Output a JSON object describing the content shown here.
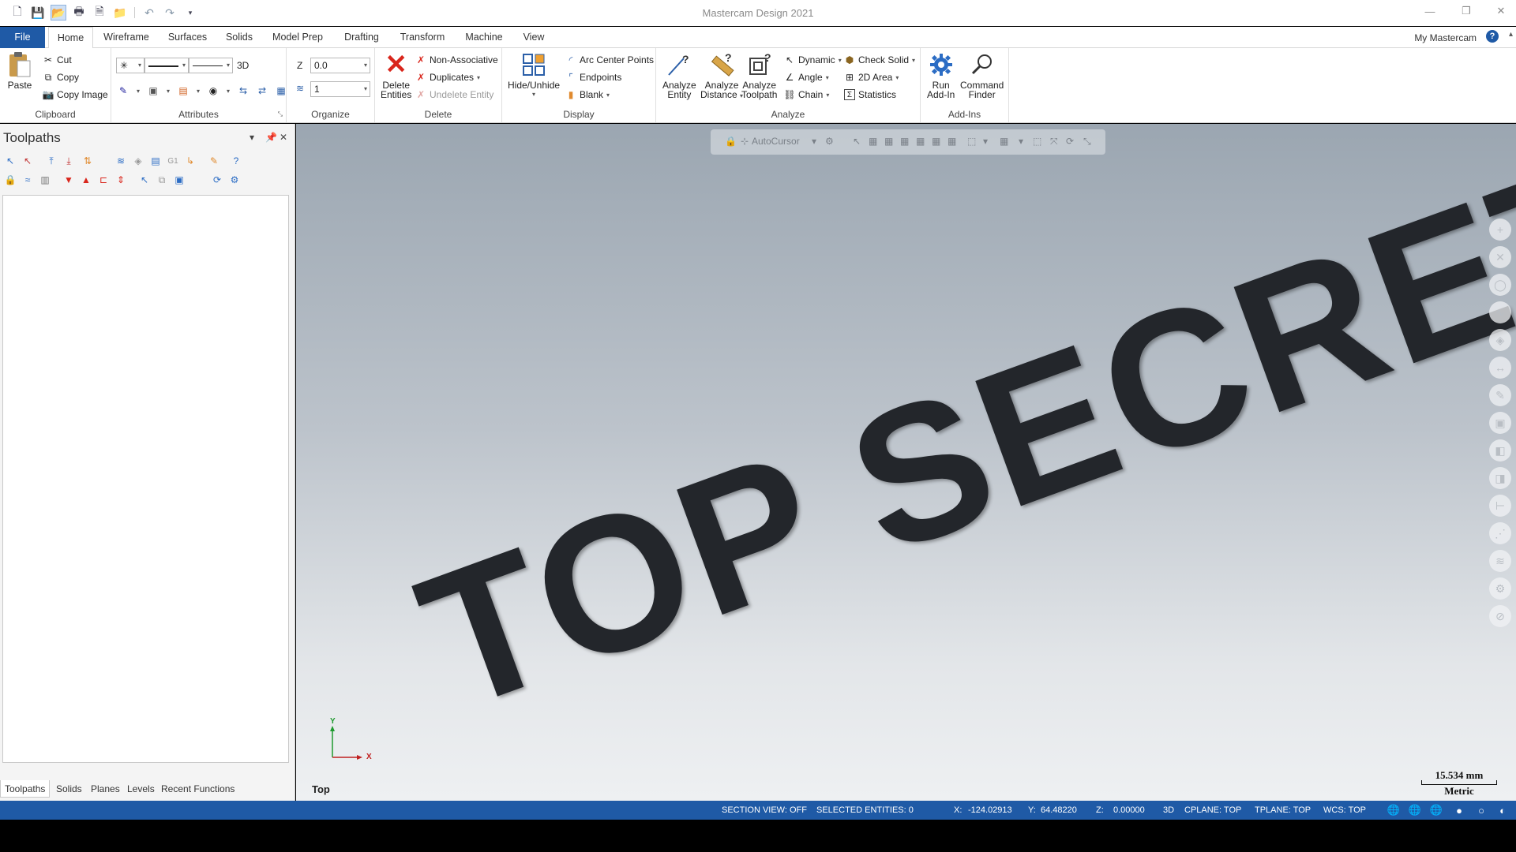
{
  "window": {
    "title": "Mastercam Design 2021"
  },
  "ribbon_tabs": [
    {
      "label": "File"
    },
    {
      "label": "Home"
    },
    {
      "label": "Wireframe"
    },
    {
      "label": "Surfaces"
    },
    {
      "label": "Solids"
    },
    {
      "label": "Model Prep"
    },
    {
      "label": "Drafting"
    },
    {
      "label": "Transform"
    },
    {
      "label": "Machine"
    },
    {
      "label": "View"
    }
  ],
  "header_right": {
    "account": "My Mastercam",
    "help": "?"
  },
  "clipboard": {
    "paste": "Paste",
    "cut": "Cut",
    "copy": "Copy",
    "copy_image": "Copy Image",
    "label": "Clipboard"
  },
  "attributes": {
    "mode": "3D",
    "label": "Attributes"
  },
  "organize": {
    "z_label": "Z",
    "z_value": "0.0",
    "level_value": "1",
    "label": "Organize"
  },
  "delete": {
    "delete_entities": "Delete\nEntities",
    "delete_line1": "Delete",
    "delete_line2": "Entities",
    "non_associative": "Non-Associative",
    "duplicates": "Duplicates",
    "undelete": "Undelete Entity",
    "label": "Delete"
  },
  "display": {
    "hide_unhide": "Hide/Unhide",
    "arc_center_points": "Arc Center Points",
    "endpoints": "Endpoints",
    "blank": "Blank",
    "label": "Display"
  },
  "analyze": {
    "entity_1": "Analyze",
    "entity_2": "Entity",
    "distance_1": "Analyze",
    "distance_2": "Distance",
    "toolpath_1": "Analyze",
    "toolpath_2": "Toolpath",
    "dynamic": "Dynamic",
    "angle": "Angle",
    "chain": "Chain",
    "check_solid": "Check Solid",
    "area_2d": "2D Area",
    "statistics": "Statistics",
    "label": "Analyze"
  },
  "addins": {
    "run_1": "Run",
    "run_2": "Add-In",
    "cmd_1": "Command",
    "cmd_2": "Finder",
    "label": "Add-Ins"
  },
  "panel": {
    "title": "Toolpaths",
    "tabs": [
      {
        "label": "Toolpaths"
      },
      {
        "label": "Solids"
      },
      {
        "label": "Planes"
      },
      {
        "label": "Levels"
      },
      {
        "label": "Recent Functions"
      }
    ]
  },
  "viewport": {
    "autocursor": "AutoCursor",
    "watermark": "TOP SECRET",
    "view_name": "Top",
    "gnomon": {
      "x": "X",
      "y": "Y"
    },
    "scale": {
      "value": "15.534 mm",
      "unit": "Metric"
    }
  },
  "status": {
    "section_view": "SECTION VIEW: OFF",
    "selected": "SELECTED ENTITIES: 0",
    "x_label": "X:",
    "x_value": "-124.02913",
    "y_label": "Y:",
    "y_value": "64.48220",
    "z_label": "Z:",
    "z_value": "0.00000",
    "mode": "3D",
    "cplane": "CPLANE: TOP",
    "tplane": "TPLANE: TOP",
    "wcs": "WCS: TOP"
  },
  "colors": {
    "accent": "#1f5aa6",
    "watermark": "#23262b",
    "delete_red": "#d9261c"
  }
}
